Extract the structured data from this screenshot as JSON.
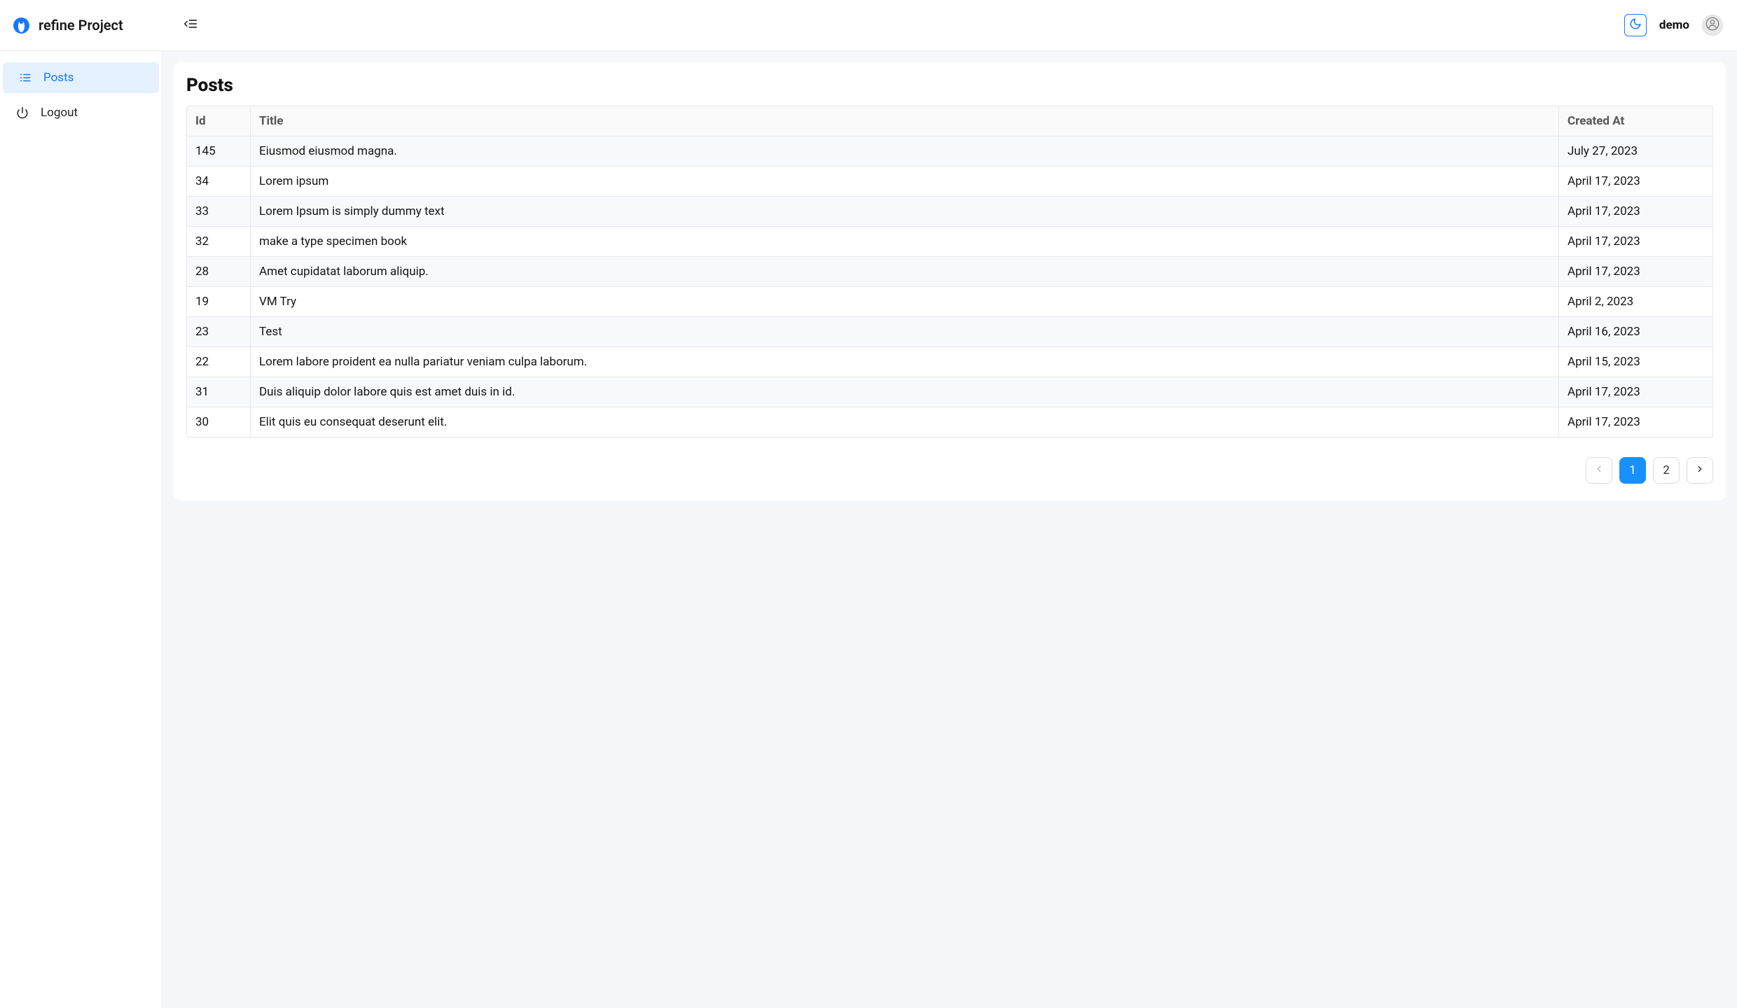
{
  "brand": {
    "title": "refine Project"
  },
  "user": {
    "name": "demo"
  },
  "sidebar": {
    "items": [
      {
        "label": "Posts",
        "active": true
      },
      {
        "label": "Logout",
        "active": false
      }
    ]
  },
  "page": {
    "title": "Posts"
  },
  "table": {
    "headers": {
      "id": "Id",
      "title": "Title",
      "created_at": "Created At"
    },
    "rows": [
      {
        "id": "145",
        "title": "Eiusmod eiusmod magna.",
        "created_at": "July 27, 2023"
      },
      {
        "id": "34",
        "title": "Lorem ipsum",
        "created_at": "April 17, 2023"
      },
      {
        "id": "33",
        "title": "Lorem Ipsum is simply dummy text",
        "created_at": "April 17, 2023"
      },
      {
        "id": "32",
        "title": "make a type specimen book",
        "created_at": "April 17, 2023"
      },
      {
        "id": "28",
        "title": "Amet cupidatat laborum aliquip.",
        "created_at": "April 17, 2023"
      },
      {
        "id": "19",
        "title": "VM Try",
        "created_at": "April 2, 2023"
      },
      {
        "id": "23",
        "title": "Test",
        "created_at": "April 16, 2023"
      },
      {
        "id": "22",
        "title": "Lorem labore proident ea nulla pariatur veniam culpa laborum.",
        "created_at": "April 15, 2023"
      },
      {
        "id": "31",
        "title": "Duis aliquip dolor labore quis est amet duis in id.",
        "created_at": "April 17, 2023"
      },
      {
        "id": "30",
        "title": "Elit quis eu consequat deserunt elit.",
        "created_at": "April 17, 2023"
      }
    ]
  },
  "pagination": {
    "pages": [
      "1",
      "2"
    ],
    "active_index": 0,
    "prev_enabled": false,
    "next_enabled": true
  }
}
